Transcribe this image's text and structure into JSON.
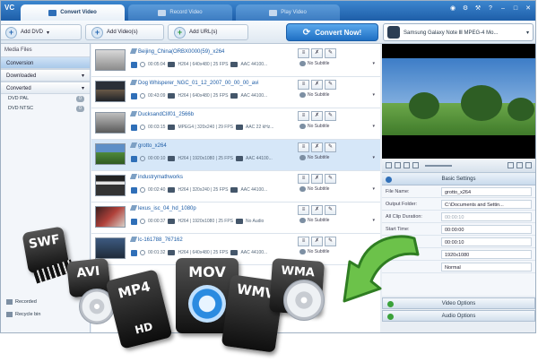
{
  "app": {
    "logo": "VC"
  },
  "tabs": [
    {
      "label": "Convert Video",
      "active": true
    },
    {
      "label": "Record Video",
      "active": false
    },
    {
      "label": "Play Video",
      "active": false
    }
  ],
  "toolbar": {
    "add_dvd": "Add DVD",
    "add_videos": "Add Video(s)",
    "add_urls": "Add URL(s)",
    "convert_now": "Convert Now!",
    "profile": "Samsung Galaxy Note Ⅲ MPEG-4 Mo..."
  },
  "sidebar": {
    "heading": "Media Files",
    "categories": [
      "Conversion",
      "Downloaded",
      "Converted"
    ],
    "items": [
      {
        "label": "DVD PAL",
        "count": "0"
      },
      {
        "label": "DVD NTSC",
        "count": "0"
      }
    ],
    "recorded": "Recorded",
    "recycle_bin": "Recycle bin"
  },
  "files": [
    {
      "title": "Beijing_China(ORBX0000(59)_x264",
      "duration": "00:05:04",
      "video": "H264 | 640x480 | 25 FPS",
      "audio": "AAC 44100...",
      "subtitle": "No Subtitle"
    },
    {
      "title": "Dog Whisperer_NGC_01_12_2007_00_00_00_avi",
      "duration": "00:43:09",
      "video": "H264 | 640x480 | 25 FPS",
      "audio": "AAC 44100...",
      "subtitle": "No Subtitle"
    },
    {
      "title": "DucksandClif01_2566b",
      "duration": "00:03:15",
      "video": "MPEG4 | 320x240 | 29 FPS",
      "audio": "AAC 22 kHz...",
      "subtitle": "No Subtitle"
    },
    {
      "title": "grotto_x264",
      "duration": "00:00:10",
      "video": "H264 | 1920x1080 | 25 FPS",
      "audio": "AAC 44100...",
      "subtitle": "No Subtitle"
    },
    {
      "title": "industrymathworks",
      "duration": "00:02:40",
      "video": "H264 | 320x240 | 25 FPS",
      "audio": "AAC 44100...",
      "subtitle": "No Subtitle"
    },
    {
      "title": "lexus_isc_04_hd_1080p",
      "duration": "00:00:37",
      "video": "H264 | 1920x1080 | 25 FPS",
      "audio": "No Audio",
      "subtitle": "No Subtitle"
    },
    {
      "title": "lc-161788_767162",
      "duration": "00:01:32",
      "video": "H264 | 640x480 | 25 FPS",
      "audio": "AAC 44100...",
      "subtitle": "No Subtitle"
    }
  ],
  "settings": {
    "heading": "Basic Settings",
    "rows": [
      {
        "key": "File Name:",
        "value": "grotto_x264"
      },
      {
        "key": "Output Folder:",
        "value": "C:\\Documents and Settin..."
      },
      {
        "key": "All Clip Duration:",
        "value": "00:00:10"
      },
      {
        "key": "Start Time:",
        "value": "00:00:00"
      },
      {
        "key": "Stop Time:",
        "value": "00:00:10"
      },
      {
        "key": "",
        "value": "1920x1080"
      },
      {
        "key": "",
        "value": "Normal"
      }
    ],
    "video_options": "Video Options",
    "audio_options": "Audio Options"
  },
  "formats": [
    "SWF",
    "AVI",
    "MP4",
    "HD",
    "MOV",
    "WMV",
    "WMA"
  ],
  "colors": {
    "accent": "#1f6fc3",
    "selection": "#d6e7f8",
    "tab_bar": "#2f6fb8"
  }
}
